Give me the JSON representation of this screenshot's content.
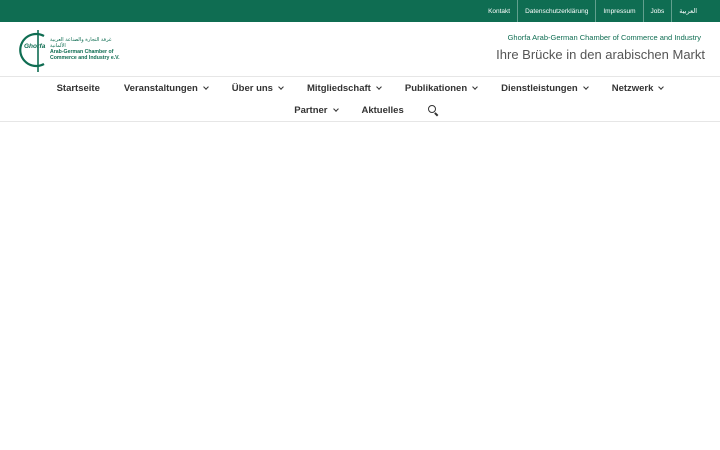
{
  "topbar": {
    "links": [
      "Kontakt",
      "Datenschutzerklärung",
      "Impressum",
      "Jobs",
      "العربية"
    ]
  },
  "header": {
    "logo": {
      "arabic": "غرفة التجارة والصناعة العربية الألمانية",
      "word": "Ghorfa",
      "en_line1": "Arab-German Chamber of",
      "en_line2": "Commerce and Industry e.V."
    },
    "tagline_small": "Ghorfa Arab-German Chamber of Commerce and Industry",
    "tagline_big": "Ihre Brücke in den arabischen Markt"
  },
  "nav": {
    "row1": [
      "Startseite",
      "Veranstaltungen",
      "Über uns",
      "Mitgliedschaft",
      "Publikationen",
      "Dienstleistungen",
      "Netzwerk"
    ],
    "row2": [
      "Partner",
      "Aktuelles"
    ]
  },
  "colors": {
    "brand": "#0f6d52"
  },
  "icons": {
    "search": "search-icon",
    "chevron": "chevron-down-icon"
  }
}
